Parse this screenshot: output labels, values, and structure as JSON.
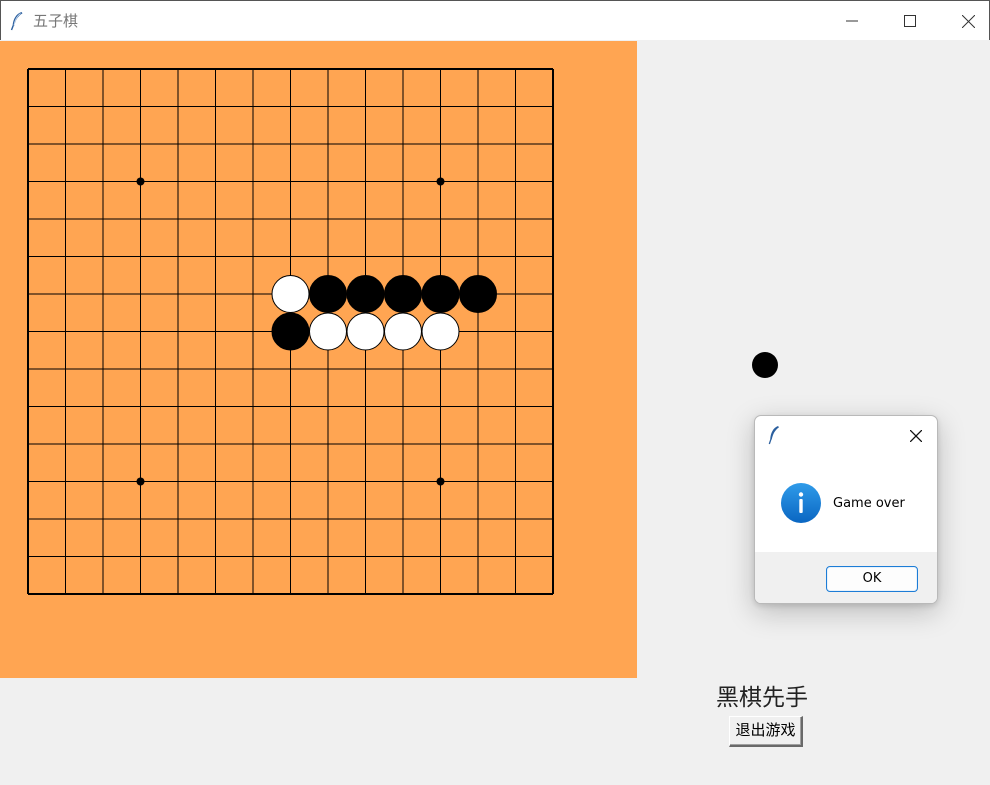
{
  "window": {
    "title": "五子棋",
    "app_icon": "feather-icon",
    "controls": [
      "minimize-icon",
      "maximize-icon",
      "close-icon"
    ]
  },
  "board": {
    "grid_lines": 15,
    "star_points": [
      [
        3,
        3
      ],
      [
        11,
        3
      ],
      [
        3,
        11
      ],
      [
        11,
        11
      ]
    ],
    "background_color": "#ffa552",
    "line_color": "#000000",
    "stones": [
      {
        "col": 7,
        "row": 6,
        "color": "white"
      },
      {
        "col": 8,
        "row": 6,
        "color": "black"
      },
      {
        "col": 9,
        "row": 6,
        "color": "black"
      },
      {
        "col": 10,
        "row": 6,
        "color": "black"
      },
      {
        "col": 11,
        "row": 6,
        "color": "black"
      },
      {
        "col": 12,
        "row": 6,
        "color": "black"
      },
      {
        "col": 7,
        "row": 7,
        "color": "black"
      },
      {
        "col": 8,
        "row": 7,
        "color": "white"
      },
      {
        "col": 9,
        "row": 7,
        "color": "white"
      },
      {
        "col": 10,
        "row": 7,
        "color": "white"
      },
      {
        "col": 11,
        "row": 7,
        "color": "white"
      }
    ]
  },
  "side_panel": {
    "turn_stone_color": "black",
    "turn_label": "黑棋先手",
    "exit_button_label": "退出游戏"
  },
  "dialog": {
    "app_icon": "feather-icon",
    "icon": "info-icon",
    "message": "Game over",
    "ok_label": "OK",
    "accent_color": "#1c7cd6"
  }
}
